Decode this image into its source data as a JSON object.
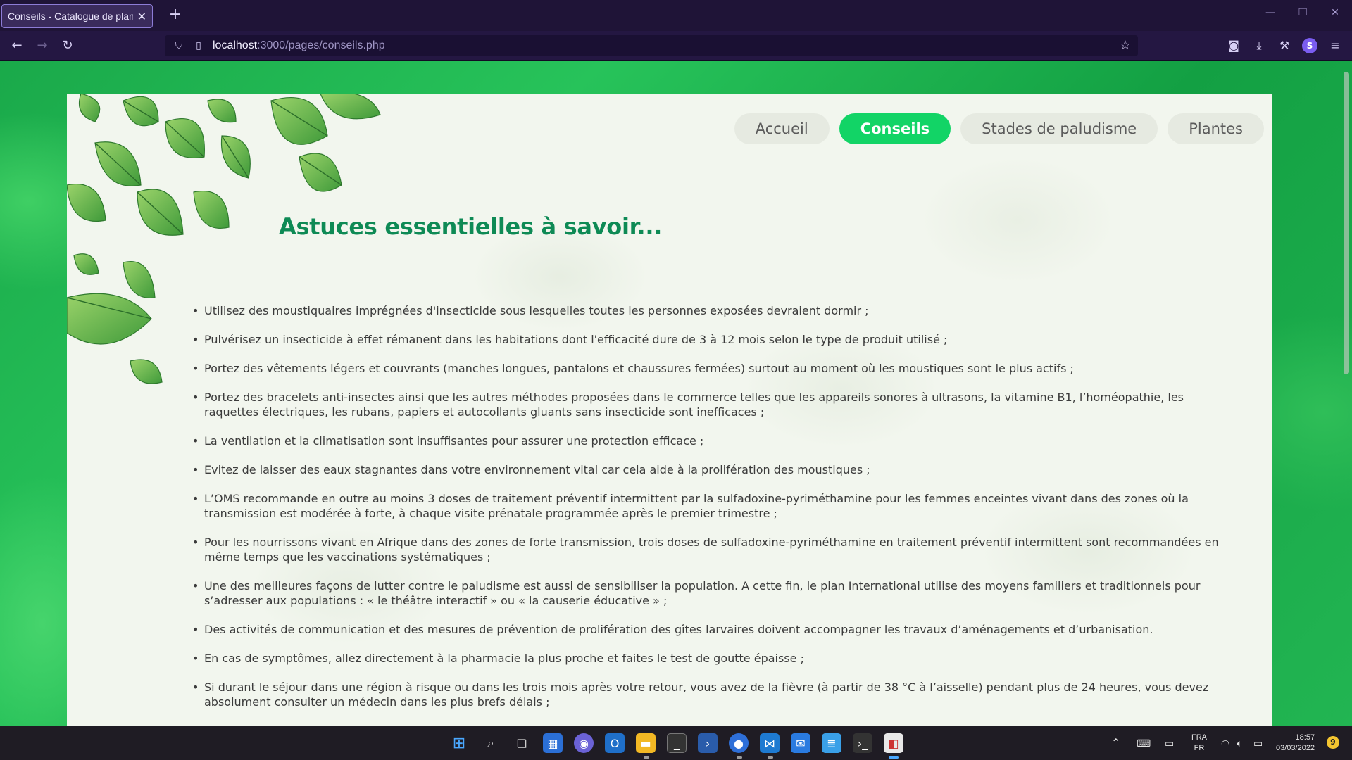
{
  "browser": {
    "tab_title": "Conseils - Catalogue de plantes",
    "url_host": "localhost",
    "url_path": ":3000/pages/conseils.php"
  },
  "site": {
    "nav": [
      {
        "label": "Accueil",
        "active": false
      },
      {
        "label": "Conseils",
        "active": true
      },
      {
        "label": "Stades de paludisme",
        "active": false
      },
      {
        "label": "Plantes",
        "active": false
      }
    ],
    "title": "Astuces essentielles à savoir...",
    "tips": [
      "Utilisez des moustiquaires imprégnées d'insecticide sous lesquelles toutes les personnes exposées devraient dormir ;",
      "Pulvérisez un insecticide à effet rémanent dans les habitations dont l'efficacité dure de 3 à 12 mois selon le type de produit utilisé ;",
      "Portez des vêtements légers et couvrants (manches longues, pantalons et chaussures fermées) surtout au moment où les moustiques sont le plus actifs ;",
      "Portez des bracelets anti-insectes ainsi que les autres méthodes proposées dans le commerce telles que les appareils sonores à ultrasons, la vitamine B1, l’homéopathie, les raquettes électriques, les rubans, papiers et autocollants gluants sans insecticide sont inefficaces ;",
      "La ventilation et la climatisation sont insuffisantes pour assurer une protection efficace ;",
      "Evitez de laisser des eaux stagnantes dans votre environnement vital car cela aide à la prolifération des moustiques ;",
      "L’OMS recommande en outre au moins 3 doses de traitement préventif intermittent par la sulfadoxine-pyriméthamine pour les femmes enceintes vivant dans des zones où la transmission est modérée à forte, à chaque visite prénatale programmée après le premier trimestre ;",
      "Pour les nourrissons vivant en Afrique dans des zones de forte transmission, trois doses de sulfadoxine-pyriméthamine en traitement préventif intermittent sont recommandées en même temps que les vaccinations systématiques ;",
      "Une des meilleures façons de lutter contre le paludisme est aussi de sensibiliser la population. A cette fin, le plan International utilise des moyens familiers et traditionnels pour s’adresser aux populations : « le théâtre interactif » ou « la causerie éducative » ;",
      "Des activités de communication et des mesures de prévention de prolifération des gîtes larvaires doivent accompagner les travaux d’aménagements et d’urbanisation.",
      "En cas de symptômes, allez directement à la pharmacie la plus proche et faites le test de goutte épaisse ;",
      "Si durant le séjour dans une région à risque ou dans les trois mois après votre retour, vous avez de la fièvre (à partir de 38 °C à l’aisselle) pendant plus de 24 heures, vous devez absolument consulter un médecin dans les plus brefs délais ;"
    ]
  },
  "taskbar": {
    "lang_top": "FRA",
    "lang_bottom": "FR",
    "time": "18:57",
    "date": "03/03/2022",
    "notification_count": "9"
  },
  "colors": {
    "accent": "#12d466",
    "title": "#0e8a55",
    "browser_bg": "#1f1437"
  }
}
